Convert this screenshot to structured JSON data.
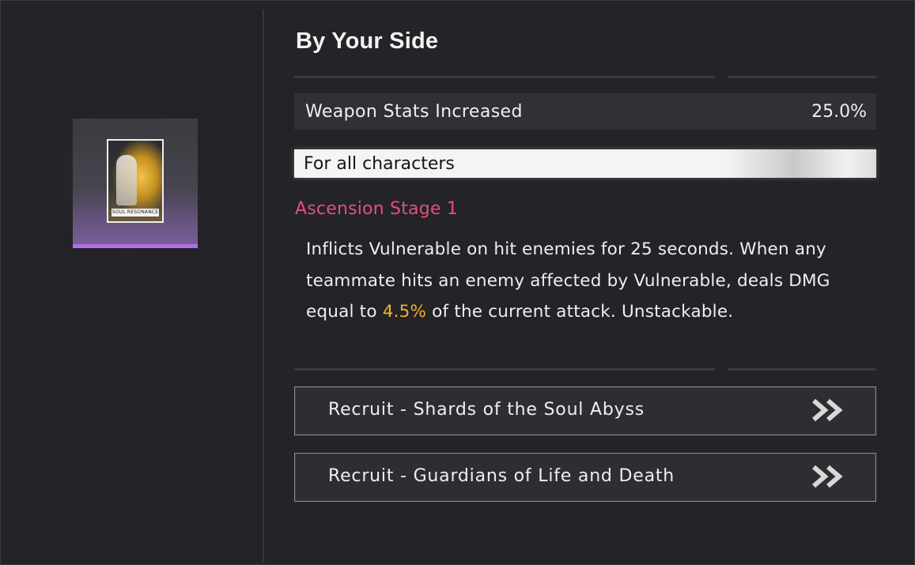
{
  "item": {
    "name": "By Your Side",
    "card_caption": "SOUL RESONANCE",
    "rarity_color": "#b56ee6"
  },
  "stat": {
    "label": "Weapon Stats Increased",
    "value": "25.0%"
  },
  "scope": "For all characters",
  "ascension": {
    "stage_label": "Ascension Stage 1",
    "stage_color": "#e0517c",
    "desc_part1": "Inflicts Vulnerable on hit enemies for 25 seconds. When any teammate hits an enemy affected by Vulnerable, deals DMG equal to ",
    "desc_highlight": "4.5%",
    "desc_part2": " of the current attack. Unstackable.",
    "highlight_color": "#efb22c"
  },
  "recruit_buttons": [
    {
      "label": "Recruit - Shards of the Soul Abyss",
      "icon": "double-chevron-right-icon"
    },
    {
      "label": "Recruit - Guardians of Life and Death",
      "icon": "double-chevron-right-icon"
    }
  ]
}
